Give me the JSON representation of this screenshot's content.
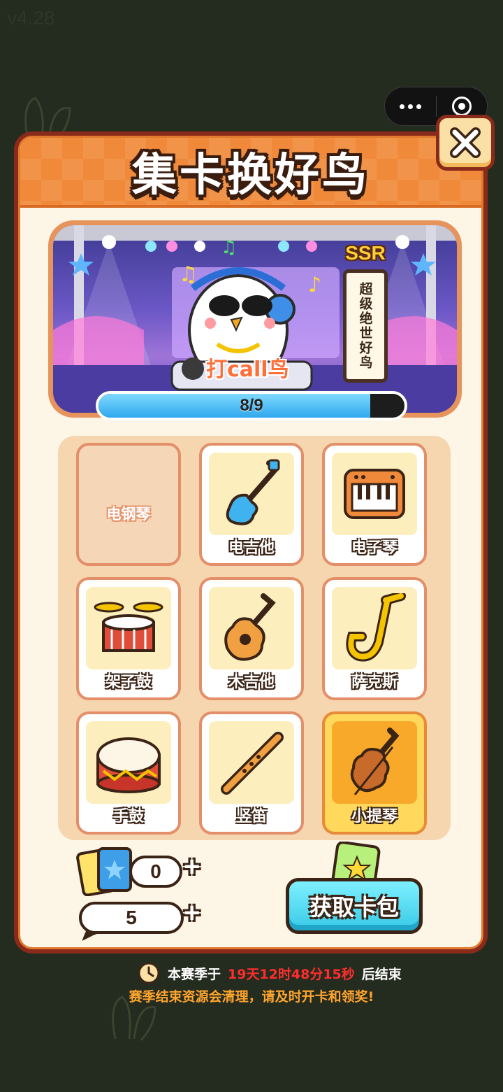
{
  "version": "v4.28",
  "title": "集卡换好鸟",
  "banner": {
    "rarity": "SSR",
    "rarity_label": "超级绝世好鸟",
    "character": "打call鸟",
    "progress": {
      "text": "8/9",
      "collected": 8,
      "total": 9
    }
  },
  "cards": [
    {
      "name": "电钢琴",
      "icon": "piano-keyboard-icon",
      "collected": false
    },
    {
      "name": "电吉他",
      "icon": "electric-guitar-icon",
      "collected": true
    },
    {
      "name": "电子琴",
      "icon": "keyboard-icon",
      "collected": true
    },
    {
      "name": "架子鼓",
      "icon": "drum-kit-icon",
      "collected": true
    },
    {
      "name": "木吉他",
      "icon": "acoustic-guitar-icon",
      "collected": true
    },
    {
      "name": "萨克斯",
      "icon": "saxophone-icon",
      "collected": true
    },
    {
      "name": "手鼓",
      "icon": "hand-drum-icon",
      "collected": true
    },
    {
      "name": "竖笛",
      "icon": "recorder-icon",
      "collected": true
    },
    {
      "name": "小提琴",
      "icon": "violin-icon",
      "collected": true,
      "highlighted": true
    }
  ],
  "resources": {
    "card_packs": "0",
    "feathers": "5",
    "plus": "+"
  },
  "get_pack_label": "获取卡包",
  "season": {
    "prefix": "本赛季于",
    "time": "19天12时48分15秒",
    "suffix": "后结束",
    "notice": "赛季结束资源会清理，请及时开卡和领奖!"
  },
  "colors": {
    "background": "#242b1f",
    "header": "#f08a3a",
    "progress_fill": "#2fa8ee",
    "countdown": "#ff2d2d",
    "notice": "#ffa52e"
  }
}
